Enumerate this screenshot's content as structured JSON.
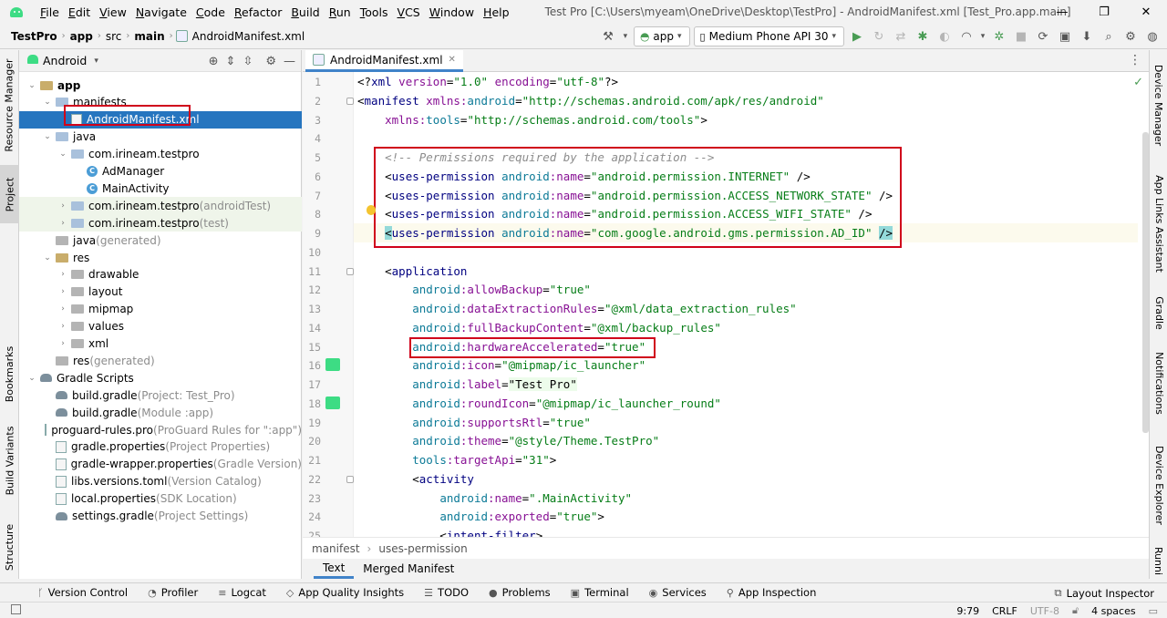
{
  "menubar": {
    "items": [
      {
        "label": "File",
        "u": "F",
        "rest": "ile"
      },
      {
        "label": "Edit",
        "u": "E",
        "rest": "dit"
      },
      {
        "label": "View",
        "u": "V",
        "rest": "iew"
      },
      {
        "label": "Navigate",
        "u": "N",
        "rest": "avigate"
      },
      {
        "label": "Code",
        "u": "C",
        "rest": "ode"
      },
      {
        "label": "Refactor",
        "u": "R",
        "rest": "efactor"
      },
      {
        "label": "Build",
        "u": "B",
        "rest": "uild"
      },
      {
        "label": "Run",
        "u": "R",
        "rest": "un"
      },
      {
        "label": "Tools",
        "u": "T",
        "rest": "ools"
      },
      {
        "label": "VCS",
        "u": "V",
        "rest": "CS"
      },
      {
        "label": "Window",
        "u": "W",
        "rest": "indow"
      },
      {
        "label": "Help",
        "u": "H",
        "rest": "elp"
      }
    ],
    "window_title": "Test Pro [C:\\Users\\myeam\\OneDrive\\Desktop\\TestPro] - AndroidManifest.xml [Test_Pro.app.main]",
    "controls": [
      "—",
      "❐",
      "✕"
    ]
  },
  "navbar": {
    "crumbs": [
      "TestPro",
      "app",
      "src",
      "main",
      "AndroidManifest.xml"
    ],
    "run_config": "app",
    "device": "Medium Phone API 30"
  },
  "left_strip": [
    "Resource Manager",
    "Project",
    "Bookmarks",
    "Build Variants",
    "Structure"
  ],
  "right_strip": [
    "Device Manager",
    "App Links Assistant",
    "Gradle",
    "Notifications",
    "Device Explorer",
    "Runni"
  ],
  "project_panel": {
    "view_name": "Android",
    "tree": [
      {
        "label": "app",
        "note": "",
        "depth": 0,
        "arrow": "⌄",
        "icon": "folder-yellow",
        "bold": true
      },
      {
        "label": "manifests",
        "note": "",
        "depth": 1,
        "arrow": "⌄",
        "icon": "folder"
      },
      {
        "label": "AndroidManifest.xml",
        "note": "",
        "depth": 2,
        "arrow": "",
        "icon": "file",
        "selected": true
      },
      {
        "label": "java",
        "note": "",
        "depth": 1,
        "arrow": "⌄",
        "icon": "folder"
      },
      {
        "label": "com.irineam.testpro",
        "note": "",
        "depth": 2,
        "arrow": "⌄",
        "icon": "folder"
      },
      {
        "label": "AdManager",
        "note": "",
        "depth": 3,
        "arrow": "",
        "icon": "class"
      },
      {
        "label": "MainActivity",
        "note": "",
        "depth": 3,
        "arrow": "",
        "icon": "class"
      },
      {
        "label": "com.irineam.testpro",
        "note": " (androidTest)",
        "depth": 2,
        "arrow": "›",
        "icon": "folder",
        "greenbg": true
      },
      {
        "label": "com.irineam.testpro",
        "note": " (test)",
        "depth": 2,
        "arrow": "›",
        "icon": "folder",
        "greenbg": true
      },
      {
        "label": "java",
        "note": " (generated)",
        "depth": 1,
        "arrow": "",
        "icon": "folder-gray"
      },
      {
        "label": "res",
        "note": "",
        "depth": 1,
        "arrow": "⌄",
        "icon": "folder-yellow"
      },
      {
        "label": "drawable",
        "note": "",
        "depth": 2,
        "arrow": "›",
        "icon": "folder-gray"
      },
      {
        "label": "layout",
        "note": "",
        "depth": 2,
        "arrow": "›",
        "icon": "folder-gray"
      },
      {
        "label": "mipmap",
        "note": "",
        "depth": 2,
        "arrow": "›",
        "icon": "folder-gray"
      },
      {
        "label": "values",
        "note": "",
        "depth": 2,
        "arrow": "›",
        "icon": "folder-gray"
      },
      {
        "label": "xml",
        "note": "",
        "depth": 2,
        "arrow": "›",
        "icon": "folder-gray"
      },
      {
        "label": "res",
        "note": " (generated)",
        "depth": 1,
        "arrow": "",
        "icon": "folder-gray"
      },
      {
        "label": "Gradle Scripts",
        "note": "",
        "depth": 0,
        "arrow": "⌄",
        "icon": "gradle"
      },
      {
        "label": "build.gradle",
        "note": " (Project: Test_Pro)",
        "depth": 1,
        "arrow": "",
        "icon": "gradle"
      },
      {
        "label": "build.gradle",
        "note": " (Module :app)",
        "depth": 1,
        "arrow": "",
        "icon": "gradle"
      },
      {
        "label": "proguard-rules.pro",
        "note": " (ProGuard Rules for \":app\")",
        "depth": 1,
        "arrow": "",
        "icon": "file"
      },
      {
        "label": "gradle.properties",
        "note": " (Project Properties)",
        "depth": 1,
        "arrow": "",
        "icon": "file"
      },
      {
        "label": "gradle-wrapper.properties",
        "note": " (Gradle Version)",
        "depth": 1,
        "arrow": "",
        "icon": "file"
      },
      {
        "label": "libs.versions.toml",
        "note": " (Version Catalog)",
        "depth": 1,
        "arrow": "",
        "icon": "file"
      },
      {
        "label": "local.properties",
        "note": " (SDK Location)",
        "depth": 1,
        "arrow": "",
        "icon": "file"
      },
      {
        "label": "settings.gradle",
        "note": " (Project Settings)",
        "depth": 1,
        "arrow": "",
        "icon": "gradle"
      }
    ]
  },
  "editor": {
    "tab_label": "AndroidManifest.xml",
    "lines": [
      [
        [
          "t-plain",
          "<?"
        ],
        [
          "t-tag",
          "xml"
        ],
        [
          "t-plain",
          " "
        ],
        [
          "t-attr",
          "version"
        ],
        [
          "t-plain",
          "="
        ],
        [
          "t-val",
          "\"1.0\""
        ],
        [
          "t-plain",
          " "
        ],
        [
          "t-attr",
          "encoding"
        ],
        [
          "t-plain",
          "="
        ],
        [
          "t-val",
          "\"utf-8\""
        ],
        [
          "t-plain",
          "?>"
        ]
      ],
      [
        [
          "t-plain",
          "<"
        ],
        [
          "t-tag",
          "manifest "
        ],
        [
          "t-attr",
          "xmlns:"
        ],
        [
          "t-ns",
          "android"
        ],
        [
          "t-plain",
          "="
        ],
        [
          "t-val",
          "\"http://schemas.android.com/apk/res/android\""
        ]
      ],
      [
        [
          "t-plain",
          "    "
        ],
        [
          "t-attr",
          "xmlns:"
        ],
        [
          "t-ns",
          "tools"
        ],
        [
          "t-plain",
          "="
        ],
        [
          "t-val",
          "\"http://schemas.android.com/tools\""
        ],
        [
          "t-plain",
          ">"
        ]
      ],
      [],
      [
        [
          "t-plain",
          "    "
        ],
        [
          "t-com",
          "<!-- Permissions required by the application -->"
        ]
      ],
      [
        [
          "t-plain",
          "    <"
        ],
        [
          "t-tag",
          "uses-permission "
        ],
        [
          "t-ns",
          "android"
        ],
        [
          "t-attr",
          ":name"
        ],
        [
          "t-plain",
          "="
        ],
        [
          "t-val",
          "\"android.permission.INTERNET\""
        ],
        [
          "t-plain",
          " />"
        ]
      ],
      [
        [
          "t-plain",
          "    <"
        ],
        [
          "t-tag",
          "uses-permission "
        ],
        [
          "t-ns",
          "android"
        ],
        [
          "t-attr",
          ":name"
        ],
        [
          "t-plain",
          "="
        ],
        [
          "t-val",
          "\"android.permission.ACCESS_NETWORK_STATE\""
        ],
        [
          "t-plain",
          " />"
        ]
      ],
      [
        [
          "t-plain",
          "    <"
        ],
        [
          "t-tag",
          "uses-permission "
        ],
        [
          "t-ns",
          "android"
        ],
        [
          "t-attr",
          ":name"
        ],
        [
          "t-plain",
          "="
        ],
        [
          "t-val",
          "\"android.permission.ACCESS_WIFI_STATE\""
        ],
        [
          "t-plain",
          " />"
        ]
      ],
      [
        [
          "t-plain",
          "    "
        ],
        [
          "bracket-hl",
          "<"
        ],
        [
          "t-tag",
          "uses-permission "
        ],
        [
          "t-ns",
          "android"
        ],
        [
          "t-attr",
          ":name"
        ],
        [
          "t-plain",
          "="
        ],
        [
          "t-val",
          "\"com.google.android.gms.permission.AD_ID\""
        ],
        [
          "t-plain",
          " "
        ],
        [
          "bracket-hl",
          "/>"
        ]
      ],
      [],
      [
        [
          "t-plain",
          "    <"
        ],
        [
          "t-tag",
          "application"
        ]
      ],
      [
        [
          "t-plain",
          "        "
        ],
        [
          "t-ns",
          "android"
        ],
        [
          "t-attr",
          ":allowBackup"
        ],
        [
          "t-plain",
          "="
        ],
        [
          "t-val",
          "\"true\""
        ]
      ],
      [
        [
          "t-plain",
          "        "
        ],
        [
          "t-ns",
          "android"
        ],
        [
          "t-attr",
          ":dataExtractionRules"
        ],
        [
          "t-plain",
          "="
        ],
        [
          "t-val",
          "\"@xml/data_extraction_rules\""
        ]
      ],
      [
        [
          "t-plain",
          "        "
        ],
        [
          "t-ns",
          "android"
        ],
        [
          "t-attr",
          ":fullBackupContent"
        ],
        [
          "t-plain",
          "="
        ],
        [
          "t-val",
          "\"@xml/backup_rules\""
        ]
      ],
      [
        [
          "t-plain",
          "        "
        ],
        [
          "t-ns",
          "android"
        ],
        [
          "t-attr",
          ":hardwareAccelerated"
        ],
        [
          "t-plain",
          "="
        ],
        [
          "t-val",
          "\"true\""
        ]
      ],
      [
        [
          "t-plain",
          "        "
        ],
        [
          "t-ns",
          "android"
        ],
        [
          "t-attr",
          ":icon"
        ],
        [
          "t-plain",
          "="
        ],
        [
          "t-val",
          "\"@mipmap/ic_launcher\""
        ]
      ],
      [
        [
          "t-plain",
          "        "
        ],
        [
          "t-ns",
          "android"
        ],
        [
          "t-attr",
          ":label"
        ],
        [
          "t-plain",
          "="
        ],
        [
          "val-hl",
          "\"Test Pro\""
        ]
      ],
      [
        [
          "t-plain",
          "        "
        ],
        [
          "t-ns",
          "android"
        ],
        [
          "t-attr",
          ":roundIcon"
        ],
        [
          "t-plain",
          "="
        ],
        [
          "t-val",
          "\"@mipmap/ic_launcher_round\""
        ]
      ],
      [
        [
          "t-plain",
          "        "
        ],
        [
          "t-ns",
          "android"
        ],
        [
          "t-attr",
          ":supportsRtl"
        ],
        [
          "t-plain",
          "="
        ],
        [
          "t-val",
          "\"true\""
        ]
      ],
      [
        [
          "t-plain",
          "        "
        ],
        [
          "t-ns",
          "android"
        ],
        [
          "t-attr",
          ":theme"
        ],
        [
          "t-plain",
          "="
        ],
        [
          "t-val",
          "\"@style/Theme.TestPro\""
        ]
      ],
      [
        [
          "t-plain",
          "        "
        ],
        [
          "t-ns",
          "tools"
        ],
        [
          "t-attr",
          ":targetApi"
        ],
        [
          "t-plain",
          "="
        ],
        [
          "t-val",
          "\"31\""
        ],
        [
          "t-plain",
          ">"
        ]
      ],
      [
        [
          "t-plain",
          "        <"
        ],
        [
          "t-tag",
          "activity"
        ]
      ],
      [
        [
          "t-plain",
          "            "
        ],
        [
          "t-ns",
          "android"
        ],
        [
          "t-attr",
          ":name"
        ],
        [
          "t-plain",
          "="
        ],
        [
          "t-val",
          "\".MainActivity\""
        ]
      ],
      [
        [
          "t-plain",
          "            "
        ],
        [
          "t-ns",
          "android"
        ],
        [
          "t-attr",
          ":exported"
        ],
        [
          "t-plain",
          "="
        ],
        [
          "t-val",
          "\"true\""
        ],
        [
          "t-plain",
          ">"
        ]
      ],
      [
        [
          "t-plain",
          "            <"
        ],
        [
          "t-tag",
          "intent-filter"
        ],
        [
          "t-plain",
          ">"
        ]
      ]
    ],
    "breadcrumb": [
      "manifest",
      "uses-permission"
    ],
    "subtabs": [
      "Text",
      "Merged Manifest"
    ]
  },
  "bottom_tools": [
    {
      "label": "Version Control",
      "icon": "ᚴ"
    },
    {
      "label": "Profiler",
      "icon": "◔"
    },
    {
      "label": "Logcat",
      "icon": "≡"
    },
    {
      "label": "App Quality Insights",
      "icon": "◇"
    },
    {
      "label": "TODO",
      "icon": "☰"
    },
    {
      "label": "Problems",
      "icon": "●"
    },
    {
      "label": "Terminal",
      "icon": "▣"
    },
    {
      "label": "Services",
      "icon": "◉"
    },
    {
      "label": "App Inspection",
      "icon": "⚲"
    }
  ],
  "layout_inspector": "Layout Inspector",
  "status": {
    "position": "9:79",
    "line_sep": "CRLF",
    "encoding": "UTF-8",
    "indent": "4 spaces"
  }
}
